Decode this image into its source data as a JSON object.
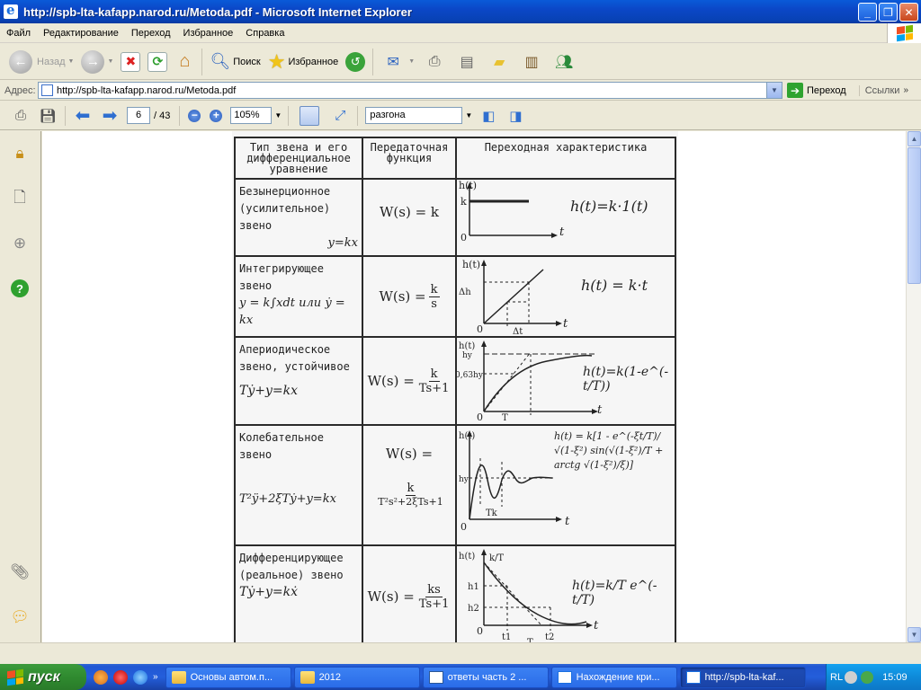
{
  "window": {
    "title": "http://spb-lta-kafapp.narod.ru/Metoda.pdf - Microsoft Internet Explorer",
    "controls": {
      "minimize": "_",
      "maximize": "❐",
      "close": "✕"
    }
  },
  "menu": [
    "Файл",
    "Редактирование",
    "Переход",
    "Избранное",
    "Справка"
  ],
  "toolbar": {
    "back_label": "Назад",
    "search_label": "Поиск",
    "favorites_label": "Избранное"
  },
  "address": {
    "label": "Адрес:",
    "url": "http://spb-lta-kafapp.narod.ru/Metoda.pdf",
    "go_label": "Переход",
    "links_label": "Ссылки"
  },
  "pdf_toolbar": {
    "page_current": "6",
    "page_total": "/ 43",
    "zoom": "105%",
    "search_text": "разгона"
  },
  "document": {
    "headers": [
      "Тип звена и его дифференциальное уравнение",
      "Передаточная функция",
      "Переходная характеристика"
    ],
    "rows": [
      {
        "name": "Безынерционное (усилительное) звено",
        "eq": "y=kx",
        "tf": "W(s) = k",
        "h": "h(t)=k·1(t)"
      },
      {
        "name": "Интегрирующее звено",
        "eq": "y = k∫xdt или ẏ = kx",
        "tf_num": "k",
        "tf_den": "s",
        "h": "h(t) = k·t"
      },
      {
        "name": "Апериодическое звено, устойчивое",
        "eq": "Tẏ+y=kx",
        "tf_num": "k",
        "tf_den": "Ts+1",
        "h": "h(t)=k(1-e^(-t/T))"
      },
      {
        "name": "Колебательное звено",
        "eq": "T²ÿ+2ξTẏ+y=kx",
        "tf_num": "k",
        "tf_den": "T²s²+2ξTs+1",
        "h": "h(t) = k[1 - e^(-ξt/T)/√(1-ξ²) sin(√(1-ξ²)/T + arctg √(1-ξ²)/ξ)]"
      },
      {
        "name": "Дифференцирующее (реальное) звено",
        "eq": "Tẏ+y=kẋ",
        "tf_num": "ks",
        "tf_den": "Ts+1",
        "h": "h(t)=k/T e^(-t/T)"
      }
    ],
    "tf_prefix": "W(s) =",
    "tf_prefix_osc": "W(s) ="
  },
  "taskbar": {
    "start": "пуск",
    "tasks": [
      {
        "label": "Основы автом.п...",
        "icon": "folder"
      },
      {
        "label": "2012",
        "icon": "folder"
      },
      {
        "label": "ответы часть 2 ...",
        "icon": "word"
      },
      {
        "label": "Нахождение кри...",
        "icon": "ie"
      },
      {
        "label": "http://spb-lta-kaf...",
        "icon": "ie",
        "active": true
      }
    ],
    "lang": "RL",
    "clock": "15:09"
  },
  "colors": {
    "titlebar": "#0b47c7",
    "taskbar": "#245edb",
    "start": "#2f8a2f",
    "tray": "#0e8ad9"
  }
}
